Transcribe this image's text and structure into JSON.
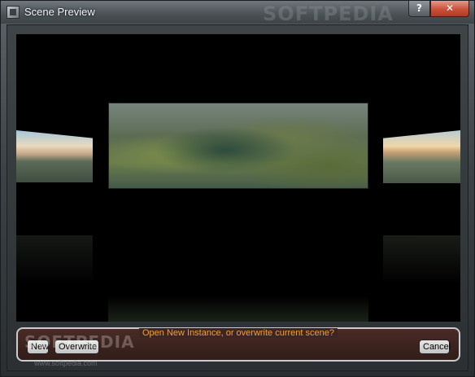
{
  "window": {
    "title": "Scene Preview",
    "help_label": "?",
    "close_label": "✕"
  },
  "watermark": {
    "top": "SOFTPEDIA",
    "middle": "SOFTPEDIA",
    "url": "www.softpedia.com"
  },
  "prompt": {
    "text": "Open New Instance, or overwrite current scene?",
    "new_label": "New",
    "overwrite_label": "Overwrite",
    "cancel_label": "Cancel"
  },
  "colors": {
    "prompt_text": "#f0a03a",
    "close_button": "#c9503a"
  },
  "icons": [
    "app-icon",
    "help-icon",
    "close-icon"
  ]
}
